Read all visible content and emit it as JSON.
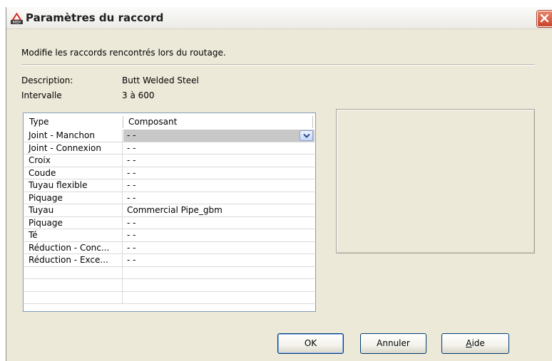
{
  "window": {
    "title": "Paramètres du raccord",
    "icon": "autocad-mep-app-icon"
  },
  "intro_text": "Modifie les raccords rencontrés lors du routage.",
  "fields": {
    "description_label": "Description:",
    "description_value": "Butt Welded Steel",
    "interval_label": "Intervalle",
    "interval_value": "3 à 600"
  },
  "grid": {
    "columns": [
      "Type",
      "Composant"
    ],
    "rows": [
      {
        "type": "Joint - Manchon",
        "component": "- -",
        "selected": true
      },
      {
        "type": "Joint - Connexion",
        "component": "- -"
      },
      {
        "type": "Croix",
        "component": "- -"
      },
      {
        "type": "Coude",
        "component": "- -"
      },
      {
        "type": "Tuyau flexible",
        "component": "- -"
      },
      {
        "type": "Piquage",
        "component": "- -"
      },
      {
        "type": "Tuyau",
        "component": "Commercial Pipe_gbm"
      },
      {
        "type": "Piquage",
        "component": "- -"
      },
      {
        "type": "Té",
        "component": "- -"
      },
      {
        "type": "Réduction - Conc...",
        "component": "- -"
      },
      {
        "type": "Réduction - Exce...",
        "component": "- -"
      },
      {
        "type": "",
        "component": ""
      },
      {
        "type": "",
        "component": ""
      },
      {
        "type": "",
        "component": ""
      }
    ]
  },
  "buttons": {
    "ok": "OK",
    "cancel": "Annuler",
    "help_accel": "A",
    "help_rest": "ide"
  },
  "colors": {
    "dialog_bg": "#ece9d8",
    "selection": "#c8c8c8",
    "close_red": "#c8452a"
  }
}
